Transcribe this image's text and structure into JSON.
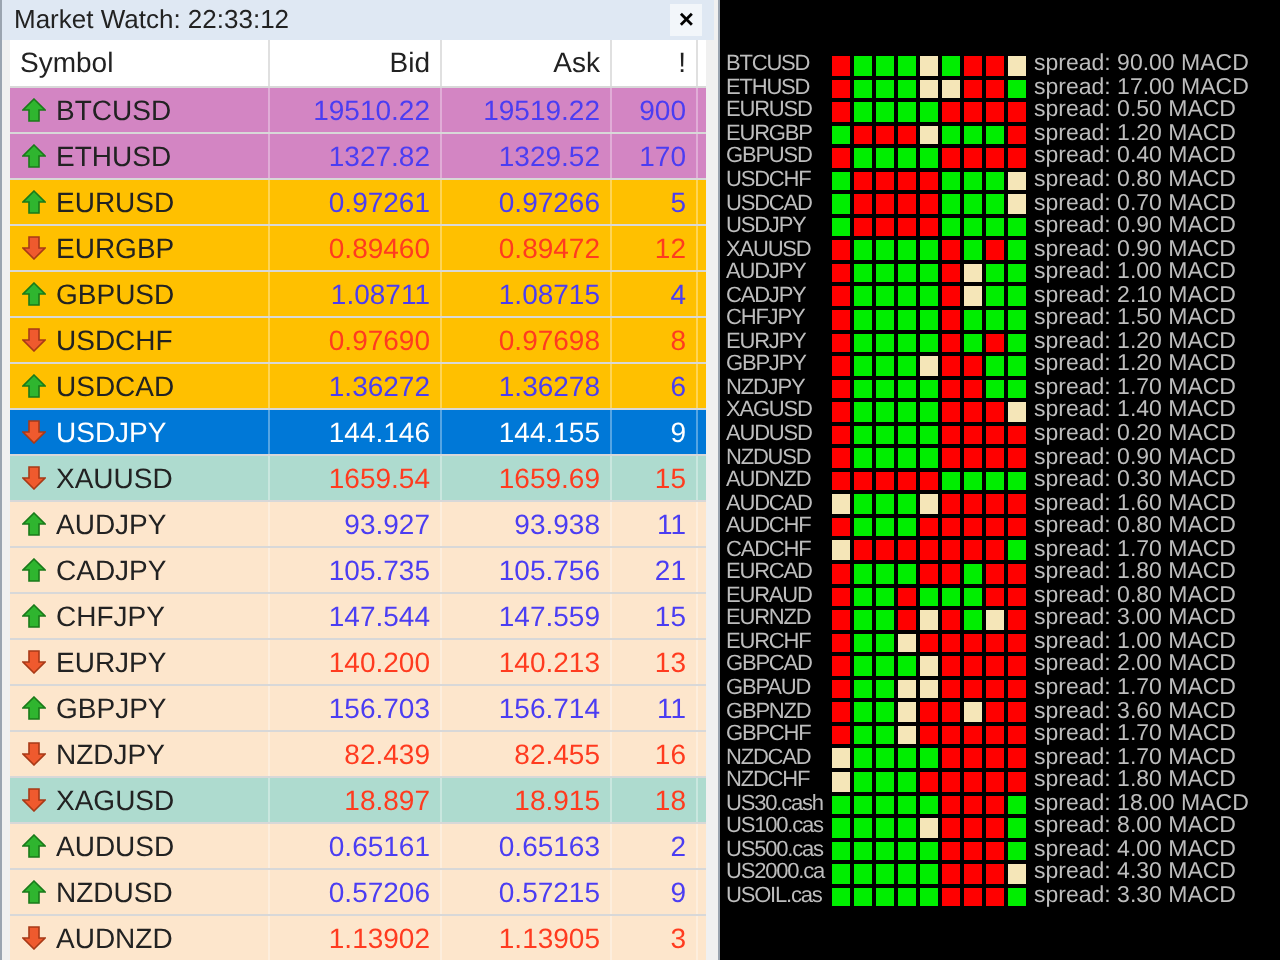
{
  "market_watch": {
    "title": "Market Watch: 22:33:12",
    "close": "×",
    "columns": [
      "Symbol",
      "Bid",
      "Ask",
      "!"
    ],
    "rows": [
      {
        "symbol": "BTCUSD",
        "bid": "19510.22",
        "ask": "19519.22",
        "spread": "900",
        "kind": "up",
        "color": "#d385c3",
        "selected": false
      },
      {
        "symbol": "ETHUSD",
        "bid": "1327.82",
        "ask": "1329.52",
        "spread": "170",
        "kind": "up",
        "color": "#d385c3",
        "selected": false
      },
      {
        "symbol": "EURUSD",
        "bid": "0.97261",
        "ask": "0.97266",
        "spread": "5",
        "kind": "up",
        "color": "#ffc000",
        "selected": false
      },
      {
        "symbol": "EURGBP",
        "bid": "0.89460",
        "ask": "0.89472",
        "spread": "12",
        "kind": "down",
        "color": "#ffc000",
        "selected": false
      },
      {
        "symbol": "GBPUSD",
        "bid": "1.08711",
        "ask": "1.08715",
        "spread": "4",
        "kind": "up",
        "color": "#ffc000",
        "selected": false
      },
      {
        "symbol": "USDCHF",
        "bid": "0.97690",
        "ask": "0.97698",
        "spread": "8",
        "kind": "down",
        "color": "#ffc000",
        "selected": false
      },
      {
        "symbol": "USDCAD",
        "bid": "1.36272",
        "ask": "1.36278",
        "spread": "6",
        "kind": "up",
        "color": "#ffc000",
        "selected": false
      },
      {
        "symbol": "USDJPY",
        "bid": "144.146",
        "ask": "144.155",
        "spread": "9",
        "kind": "down",
        "color": "#0078d7",
        "selected": true
      },
      {
        "symbol": "XAUUSD",
        "bid": "1659.54",
        "ask": "1659.69",
        "spread": "15",
        "kind": "down",
        "color": "#aedbcf",
        "selected": false
      },
      {
        "symbol": "AUDJPY",
        "bid": "93.927",
        "ask": "93.938",
        "spread": "11",
        "kind": "up",
        "color": "#fde6cc",
        "selected": false
      },
      {
        "symbol": "CADJPY",
        "bid": "105.735",
        "ask": "105.756",
        "spread": "21",
        "kind": "up",
        "color": "#fde6cc",
        "selected": false
      },
      {
        "symbol": "CHFJPY",
        "bid": "147.544",
        "ask": "147.559",
        "spread": "15",
        "kind": "up",
        "color": "#fde6cc",
        "selected": false
      },
      {
        "symbol": "EURJPY",
        "bid": "140.200",
        "ask": "140.213",
        "spread": "13",
        "kind": "down",
        "color": "#fde6cc",
        "selected": false
      },
      {
        "symbol": "GBPJPY",
        "bid": "156.703",
        "ask": "156.714",
        "spread": "11",
        "kind": "up",
        "color": "#fde6cc",
        "selected": false
      },
      {
        "symbol": "NZDJPY",
        "bid": "82.439",
        "ask": "82.455",
        "spread": "16",
        "kind": "down",
        "color": "#fde6cc",
        "selected": false
      },
      {
        "symbol": "XAGUSD",
        "bid": "18.897",
        "ask": "18.915",
        "spread": "18",
        "kind": "down",
        "color": "#aedbcf",
        "selected": false
      },
      {
        "symbol": "AUDUSD",
        "bid": "0.65161",
        "ask": "0.65163",
        "spread": "2",
        "kind": "up",
        "color": "#fde6cc",
        "selected": false
      },
      {
        "symbol": "NZDUSD",
        "bid": "0.57206",
        "ask": "0.57215",
        "spread": "9",
        "kind": "up",
        "color": "#fde6cc",
        "selected": false
      },
      {
        "symbol": "AUDNZD",
        "bid": "1.13902",
        "ask": "1.13905",
        "spread": "3",
        "kind": "down",
        "color": "#fde6cc",
        "selected": false
      }
    ]
  },
  "signal_panel": {
    "rows": [
      {
        "symbol": "BTCUSD",
        "cells": [
          {
            "color": "#ff0000"
          },
          {
            "color": "#00ee00"
          },
          {
            "color": "#00ee00"
          },
          {
            "color": "#00ee00"
          },
          {
            "color": "#f5e6b8"
          },
          {
            "color": "#00ee00"
          },
          {
            "color": "#ff0000"
          },
          {
            "color": "#ff0000"
          },
          {
            "color": "#f5e6b8"
          }
        ],
        "spread": "spread: 90.00 MACD"
      },
      {
        "symbol": "ETHUSD",
        "cells": [
          {
            "color": "#ff0000"
          },
          {
            "color": "#00ee00"
          },
          {
            "color": "#00ee00"
          },
          {
            "color": "#00ee00"
          },
          {
            "color": "#f5e6b8"
          },
          {
            "color": "#f5e6b8"
          },
          {
            "color": "#ff0000"
          },
          {
            "color": "#ff0000"
          },
          {
            "color": "#00ee00"
          }
        ],
        "spread": "spread: 17.00 MACD"
      },
      {
        "symbol": "EURUSD",
        "cells": [
          {
            "color": "#ff0000"
          },
          {
            "color": "#00ee00"
          },
          {
            "color": "#00ee00"
          },
          {
            "color": "#00ee00"
          },
          {
            "color": "#00ee00"
          },
          {
            "color": "#ff0000"
          },
          {
            "color": "#ff0000"
          },
          {
            "color": "#ff0000"
          },
          {
            "color": "#ff0000"
          }
        ],
        "spread": "spread: 0.50 MACD"
      },
      {
        "symbol": "EURGBP",
        "cells": [
          {
            "color": "#00ee00"
          },
          {
            "color": "#ff0000"
          },
          {
            "color": "#ff0000"
          },
          {
            "color": "#ff0000"
          },
          {
            "color": "#f5e6b8"
          },
          {
            "color": "#00ee00"
          },
          {
            "color": "#00ee00"
          },
          {
            "color": "#00ee00"
          },
          {
            "color": "#ff0000"
          }
        ],
        "spread": "spread: 1.20 MACD"
      },
      {
        "symbol": "GBPUSD",
        "cells": [
          {
            "color": "#ff0000"
          },
          {
            "color": "#00ee00"
          },
          {
            "color": "#00ee00"
          },
          {
            "color": "#00ee00"
          },
          {
            "color": "#00ee00"
          },
          {
            "color": "#ff0000"
          },
          {
            "color": "#ff0000"
          },
          {
            "color": "#ff0000"
          },
          {
            "color": "#ff0000"
          }
        ],
        "spread": "spread: 0.40 MACD"
      },
      {
        "symbol": "USDCHF",
        "cells": [
          {
            "color": "#00ee00"
          },
          {
            "color": "#ff0000"
          },
          {
            "color": "#ff0000"
          },
          {
            "color": "#ff0000"
          },
          {
            "color": "#ff0000"
          },
          {
            "color": "#00ee00"
          },
          {
            "color": "#00ee00"
          },
          {
            "color": "#00ee00"
          },
          {
            "color": "#f5e6b8"
          }
        ],
        "spread": "spread: 0.80 MACD"
      },
      {
        "symbol": "USDCAD",
        "cells": [
          {
            "color": "#00ee00"
          },
          {
            "color": "#ff0000"
          },
          {
            "color": "#ff0000"
          },
          {
            "color": "#ff0000"
          },
          {
            "color": "#ff0000"
          },
          {
            "color": "#00ee00"
          },
          {
            "color": "#00ee00"
          },
          {
            "color": "#00ee00"
          },
          {
            "color": "#f5e6b8"
          }
        ],
        "spread": "spread: 0.70 MACD"
      },
      {
        "symbol": "USDJPY",
        "cells": [
          {
            "color": "#00ee00"
          },
          {
            "color": "#ff0000"
          },
          {
            "color": "#ff0000"
          },
          {
            "color": "#ff0000"
          },
          {
            "color": "#ff0000"
          },
          {
            "color": "#00ee00"
          },
          {
            "color": "#00ee00"
          },
          {
            "color": "#00ee00"
          },
          {
            "color": "#00ee00"
          }
        ],
        "spread": "spread: 0.90 MACD"
      },
      {
        "symbol": "XAUUSD",
        "cells": [
          {
            "color": "#ff0000"
          },
          {
            "color": "#00ee00"
          },
          {
            "color": "#00ee00"
          },
          {
            "color": "#00ee00"
          },
          {
            "color": "#00ee00"
          },
          {
            "color": "#ff0000"
          },
          {
            "color": "#00ee00"
          },
          {
            "color": "#ff0000"
          },
          {
            "color": "#00ee00"
          }
        ],
        "spread": "spread: 0.90 MACD"
      },
      {
        "symbol": "AUDJPY",
        "cells": [
          {
            "color": "#ff0000"
          },
          {
            "color": "#00ee00"
          },
          {
            "color": "#00ee00"
          },
          {
            "color": "#00ee00"
          },
          {
            "color": "#00ee00"
          },
          {
            "color": "#ff0000"
          },
          {
            "color": "#f5e6b8"
          },
          {
            "color": "#00ee00"
          },
          {
            "color": "#00ee00"
          }
        ],
        "spread": "spread: 1.00 MACD"
      },
      {
        "symbol": "CADJPY",
        "cells": [
          {
            "color": "#ff0000"
          },
          {
            "color": "#00ee00"
          },
          {
            "color": "#00ee00"
          },
          {
            "color": "#00ee00"
          },
          {
            "color": "#00ee00"
          },
          {
            "color": "#ff0000"
          },
          {
            "color": "#f5e6b8"
          },
          {
            "color": "#00ee00"
          },
          {
            "color": "#00ee00"
          }
        ],
        "spread": "spread: 2.10 MACD"
      },
      {
        "symbol": "CHFJPY",
        "cells": [
          {
            "color": "#ff0000"
          },
          {
            "color": "#00ee00"
          },
          {
            "color": "#00ee00"
          },
          {
            "color": "#00ee00"
          },
          {
            "color": "#00ee00"
          },
          {
            "color": "#ff0000"
          },
          {
            "color": "#00ee00"
          },
          {
            "color": "#00ee00"
          },
          {
            "color": "#00ee00"
          }
        ],
        "spread": "spread: 1.50 MACD"
      },
      {
        "symbol": "EURJPY",
        "cells": [
          {
            "color": "#ff0000"
          },
          {
            "color": "#00ee00"
          },
          {
            "color": "#00ee00"
          },
          {
            "color": "#00ee00"
          },
          {
            "color": "#00ee00"
          },
          {
            "color": "#ff0000"
          },
          {
            "color": "#00ee00"
          },
          {
            "color": "#ff0000"
          },
          {
            "color": "#00ee00"
          }
        ],
        "spread": "spread: 1.20 MACD"
      },
      {
        "symbol": "GBPJPY",
        "cells": [
          {
            "color": "#ff0000"
          },
          {
            "color": "#00ee00"
          },
          {
            "color": "#00ee00"
          },
          {
            "color": "#00ee00"
          },
          {
            "color": "#f5e6b8"
          },
          {
            "color": "#ff0000"
          },
          {
            "color": "#ff0000"
          },
          {
            "color": "#00ee00"
          },
          {
            "color": "#00ee00"
          }
        ],
        "spread": "spread: 1.20 MACD"
      },
      {
        "symbol": "NZDJPY",
        "cells": [
          {
            "color": "#ff0000"
          },
          {
            "color": "#00ee00"
          },
          {
            "color": "#00ee00"
          },
          {
            "color": "#00ee00"
          },
          {
            "color": "#00ee00"
          },
          {
            "color": "#ff0000"
          },
          {
            "color": "#ff0000"
          },
          {
            "color": "#00ee00"
          },
          {
            "color": "#00ee00"
          }
        ],
        "spread": "spread: 1.70 MACD"
      },
      {
        "symbol": "XAGUSD",
        "cells": [
          {
            "color": "#ff0000"
          },
          {
            "color": "#00ee00"
          },
          {
            "color": "#00ee00"
          },
          {
            "color": "#00ee00"
          },
          {
            "color": "#00ee00"
          },
          {
            "color": "#ff0000"
          },
          {
            "color": "#ff0000"
          },
          {
            "color": "#ff0000"
          },
          {
            "color": "#f5e6b8"
          }
        ],
        "spread": "spread: 1.40 MACD"
      },
      {
        "symbol": "AUDUSD",
        "cells": [
          {
            "color": "#ff0000"
          },
          {
            "color": "#00ee00"
          },
          {
            "color": "#00ee00"
          },
          {
            "color": "#00ee00"
          },
          {
            "color": "#00ee00"
          },
          {
            "color": "#ff0000"
          },
          {
            "color": "#ff0000"
          },
          {
            "color": "#ff0000"
          },
          {
            "color": "#ff0000"
          }
        ],
        "spread": "spread: 0.20 MACD"
      },
      {
        "symbol": "NZDUSD",
        "cells": [
          {
            "color": "#ff0000"
          },
          {
            "color": "#00ee00"
          },
          {
            "color": "#00ee00"
          },
          {
            "color": "#00ee00"
          },
          {
            "color": "#00ee00"
          },
          {
            "color": "#ff0000"
          },
          {
            "color": "#ff0000"
          },
          {
            "color": "#ff0000"
          },
          {
            "color": "#ff0000"
          }
        ],
        "spread": "spread: 0.90 MACD"
      },
      {
        "symbol": "AUDNZD",
        "cells": [
          {
            "color": "#ff0000"
          },
          {
            "color": "#ff0000"
          },
          {
            "color": "#ff0000"
          },
          {
            "color": "#ff0000"
          },
          {
            "color": "#ff0000"
          },
          {
            "color": "#00ee00"
          },
          {
            "color": "#00ee00"
          },
          {
            "color": "#00ee00"
          },
          {
            "color": "#00ee00"
          }
        ],
        "spread": "spread: 0.30 MACD"
      },
      {
        "symbol": "AUDCAD",
        "cells": [
          {
            "color": "#f5e6b8"
          },
          {
            "color": "#00ee00"
          },
          {
            "color": "#00ee00"
          },
          {
            "color": "#00ee00"
          },
          {
            "color": "#f5e6b8"
          },
          {
            "color": "#ff0000"
          },
          {
            "color": "#ff0000"
          },
          {
            "color": "#ff0000"
          },
          {
            "color": "#ff0000"
          }
        ],
        "spread": "spread: 1.60 MACD"
      },
      {
        "symbol": "AUDCHF",
        "cells": [
          {
            "color": "#ff0000"
          },
          {
            "color": "#00ee00"
          },
          {
            "color": "#00ee00"
          },
          {
            "color": "#00ee00"
          },
          {
            "color": "#ff0000"
          },
          {
            "color": "#ff0000"
          },
          {
            "color": "#ff0000"
          },
          {
            "color": "#ff0000"
          },
          {
            "color": "#ff0000"
          }
        ],
        "spread": "spread: 0.80 MACD"
      },
      {
        "symbol": "CADCHF",
        "cells": [
          {
            "color": "#f5e6b8"
          },
          {
            "color": "#ff0000"
          },
          {
            "color": "#ff0000"
          },
          {
            "color": "#ff0000"
          },
          {
            "color": "#ff0000"
          },
          {
            "color": "#ff0000"
          },
          {
            "color": "#ff0000"
          },
          {
            "color": "#ff0000"
          },
          {
            "color": "#00ee00"
          }
        ],
        "spread": "spread: 1.70 MACD"
      },
      {
        "symbol": "EURCAD",
        "cells": [
          {
            "color": "#ff0000"
          },
          {
            "color": "#00ee00"
          },
          {
            "color": "#00ee00"
          },
          {
            "color": "#00ee00"
          },
          {
            "color": "#ff0000"
          },
          {
            "color": "#ff0000"
          },
          {
            "color": "#00ee00"
          },
          {
            "color": "#ff0000"
          },
          {
            "color": "#ff0000"
          }
        ],
        "spread": "spread: 1.80 MACD"
      },
      {
        "symbol": "EURAUD",
        "cells": [
          {
            "color": "#ff0000"
          },
          {
            "color": "#00ee00"
          },
          {
            "color": "#00ee00"
          },
          {
            "color": "#ff0000"
          },
          {
            "color": "#00ee00"
          },
          {
            "color": "#00ee00"
          },
          {
            "color": "#00ee00"
          },
          {
            "color": "#ff0000"
          },
          {
            "color": "#ff0000"
          }
        ],
        "spread": "spread: 0.80 MACD"
      },
      {
        "symbol": "EURNZD",
        "cells": [
          {
            "color": "#ff0000"
          },
          {
            "color": "#00ee00"
          },
          {
            "color": "#00ee00"
          },
          {
            "color": "#ff0000"
          },
          {
            "color": "#f5e6b8"
          },
          {
            "color": "#ff0000"
          },
          {
            "color": "#00ee00"
          },
          {
            "color": "#f5e6b8"
          },
          {
            "color": "#ff0000"
          }
        ],
        "spread": "spread: 3.00 MACD"
      },
      {
        "symbol": "EURCHF",
        "cells": [
          {
            "color": "#ff0000"
          },
          {
            "color": "#00ee00"
          },
          {
            "color": "#00ee00"
          },
          {
            "color": "#f5e6b8"
          },
          {
            "color": "#ff0000"
          },
          {
            "color": "#ff0000"
          },
          {
            "color": "#ff0000"
          },
          {
            "color": "#ff0000"
          },
          {
            "color": "#ff0000"
          }
        ],
        "spread": "spread: 1.00 MACD"
      },
      {
        "symbol": "GBPCAD",
        "cells": [
          {
            "color": "#ff0000"
          },
          {
            "color": "#00ee00"
          },
          {
            "color": "#00ee00"
          },
          {
            "color": "#00ee00"
          },
          {
            "color": "#f5e6b8"
          },
          {
            "color": "#ff0000"
          },
          {
            "color": "#ff0000"
          },
          {
            "color": "#ff0000"
          },
          {
            "color": "#ff0000"
          }
        ],
        "spread": "spread: 2.00 MACD"
      },
      {
        "symbol": "GBPAUD",
        "cells": [
          {
            "color": "#ff0000"
          },
          {
            "color": "#00ee00"
          },
          {
            "color": "#00ee00"
          },
          {
            "color": "#f5e6b8"
          },
          {
            "color": "#f5e6b8"
          },
          {
            "color": "#ff0000"
          },
          {
            "color": "#ff0000"
          },
          {
            "color": "#ff0000"
          },
          {
            "color": "#ff0000"
          }
        ],
        "spread": "spread: 1.70 MACD"
      },
      {
        "symbol": "GBPNZD",
        "cells": [
          {
            "color": "#ff0000"
          },
          {
            "color": "#00ee00"
          },
          {
            "color": "#00ee00"
          },
          {
            "color": "#f5e6b8"
          },
          {
            "color": "#ff0000"
          },
          {
            "color": "#ff0000"
          },
          {
            "color": "#f5e6b8"
          },
          {
            "color": "#ff0000"
          },
          {
            "color": "#ff0000"
          }
        ],
        "spread": "spread: 3.60 MACD"
      },
      {
        "symbol": "GBPCHF",
        "cells": [
          {
            "color": "#ff0000"
          },
          {
            "color": "#00ee00"
          },
          {
            "color": "#00ee00"
          },
          {
            "color": "#f5e6b8"
          },
          {
            "color": "#ff0000"
          },
          {
            "color": "#ff0000"
          },
          {
            "color": "#ff0000"
          },
          {
            "color": "#ff0000"
          },
          {
            "color": "#ff0000"
          }
        ],
        "spread": "spread: 1.70 MACD"
      },
      {
        "symbol": "NZDCAD",
        "cells": [
          {
            "color": "#f5e6b8"
          },
          {
            "color": "#00ee00"
          },
          {
            "color": "#00ee00"
          },
          {
            "color": "#00ee00"
          },
          {
            "color": "#00ee00"
          },
          {
            "color": "#ff0000"
          },
          {
            "color": "#ff0000"
          },
          {
            "color": "#ff0000"
          },
          {
            "color": "#ff0000"
          }
        ],
        "spread": "spread: 1.70 MACD"
      },
      {
        "symbol": "NZDCHF",
        "cells": [
          {
            "color": "#f5e6b8"
          },
          {
            "color": "#00ee00"
          },
          {
            "color": "#00ee00"
          },
          {
            "color": "#00ee00"
          },
          {
            "color": "#ff0000"
          },
          {
            "color": "#ff0000"
          },
          {
            "color": "#ff0000"
          },
          {
            "color": "#ff0000"
          },
          {
            "color": "#ff0000"
          }
        ],
        "spread": "spread: 1.80 MACD"
      },
      {
        "symbol": "US30.cash",
        "cells": [
          {
            "color": "#00ee00"
          },
          {
            "color": "#00ee00"
          },
          {
            "color": "#00ee00"
          },
          {
            "color": "#00ee00"
          },
          {
            "color": "#00ee00"
          },
          {
            "color": "#ff0000"
          },
          {
            "color": "#ff0000"
          },
          {
            "color": "#ff0000"
          },
          {
            "color": "#00ee00"
          }
        ],
        "spread": "spread: 18.00 MACD"
      },
      {
        "symbol": "US100.cas",
        "cells": [
          {
            "color": "#00ee00"
          },
          {
            "color": "#00ee00"
          },
          {
            "color": "#00ee00"
          },
          {
            "color": "#00ee00"
          },
          {
            "color": "#f5e6b8"
          },
          {
            "color": "#ff0000"
          },
          {
            "color": "#ff0000"
          },
          {
            "color": "#ff0000"
          },
          {
            "color": "#00ee00"
          }
        ],
        "spread": "spread: 8.00 MACD"
      },
      {
        "symbol": "US500.cas",
        "cells": [
          {
            "color": "#00ee00"
          },
          {
            "color": "#00ee00"
          },
          {
            "color": "#00ee00"
          },
          {
            "color": "#00ee00"
          },
          {
            "color": "#00ee00"
          },
          {
            "color": "#ff0000"
          },
          {
            "color": "#ff0000"
          },
          {
            "color": "#ff0000"
          },
          {
            "color": "#00ee00"
          }
        ],
        "spread": "spread: 4.00 MACD"
      },
      {
        "symbol": "US2000.ca",
        "cells": [
          {
            "color": "#00ee00"
          },
          {
            "color": "#00ee00"
          },
          {
            "color": "#00ee00"
          },
          {
            "color": "#00ee00"
          },
          {
            "color": "#00ee00"
          },
          {
            "color": "#ff0000"
          },
          {
            "color": "#ff0000"
          },
          {
            "color": "#ff0000"
          },
          {
            "color": "#f5e6b8"
          }
        ],
        "spread": "spread: 4.30 MACD"
      },
      {
        "symbol": "USOIL.cas",
        "cells": [
          {
            "color": "#00ee00"
          },
          {
            "color": "#00ee00"
          },
          {
            "color": "#00ee00"
          },
          {
            "color": "#00ee00"
          },
          {
            "color": "#00ee00"
          },
          {
            "color": "#ff0000"
          },
          {
            "color": "#ff0000"
          },
          {
            "color": "#ff0000"
          },
          {
            "color": "#00ee00"
          }
        ],
        "spread": "spread: 3.30 MACD"
      }
    ]
  }
}
